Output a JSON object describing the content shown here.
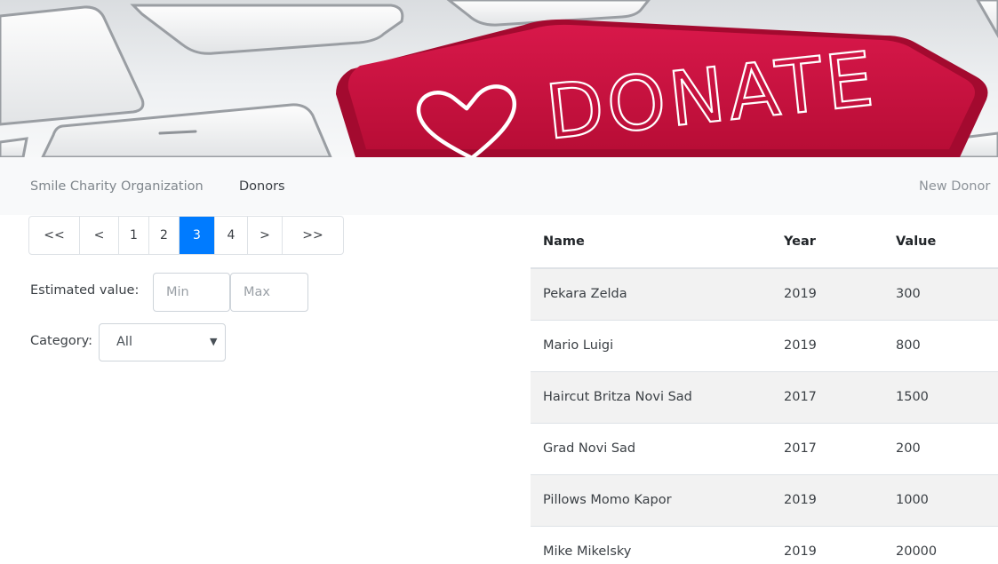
{
  "hero": {
    "key_text": "DONATE",
    "key_color": "#c8103e",
    "icon": "heart-icon"
  },
  "navbar": {
    "brand": "Smile Charity Organization",
    "donors_link": "Donors",
    "new_donor_link": "New Donor"
  },
  "pagination": {
    "first": "<<",
    "prev": "<",
    "pages": [
      "1",
      "2",
      "3",
      "4"
    ],
    "current": "3",
    "next": ">",
    "last": ">>",
    "active_color": "#007bff"
  },
  "filters": {
    "estimated_label": "Estimated value:",
    "min_placeholder": "Min",
    "max_placeholder": "Max",
    "category_label": "Category:",
    "category_selected": "All"
  },
  "table": {
    "headers": [
      "Name",
      "Year",
      "Value"
    ],
    "rows": [
      [
        "Pekara Zelda",
        "2019",
        "300"
      ],
      [
        "Mario Luigi",
        "2019",
        "800"
      ],
      [
        "Haircut Britza Novi Sad",
        "2017",
        "1500"
      ],
      [
        "Grad Novi Sad",
        "2017",
        "200"
      ],
      [
        "Pillows Momo Kapor",
        "2019",
        "1000"
      ],
      [
        "Mike Mikelsky",
        "2019",
        "20000"
      ]
    ]
  }
}
